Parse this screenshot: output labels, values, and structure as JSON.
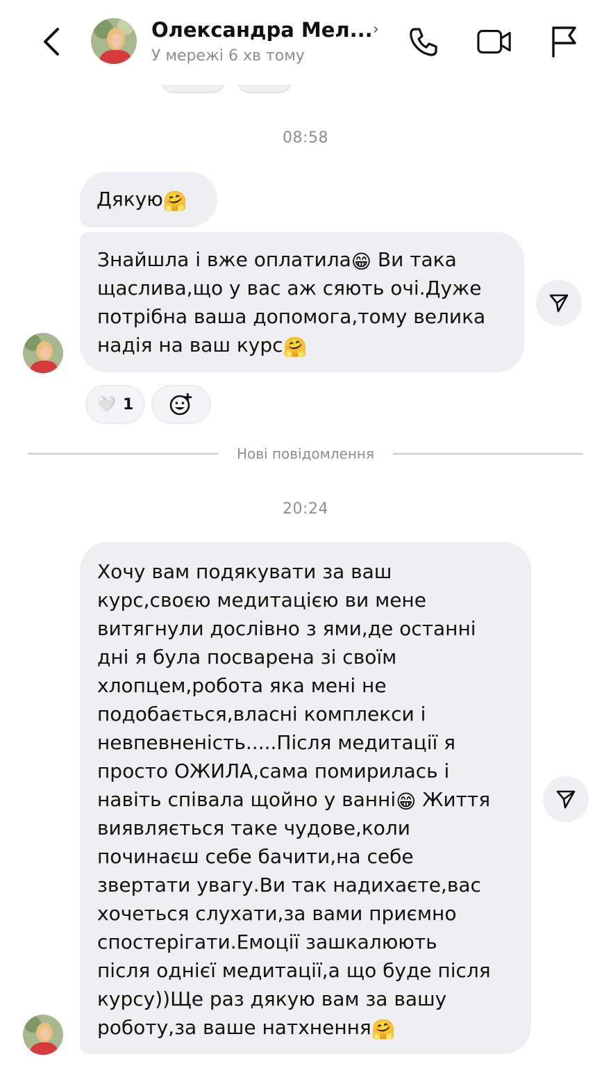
{
  "header": {
    "name": "Олександра Мел...",
    "chevron": "›",
    "status": "У мережі 6 хв тому",
    "icons": [
      "back-arrow-icon",
      "phone-icon",
      "video-camera-icon",
      "flag-icon"
    ]
  },
  "conversation": {
    "time_1": "08:58",
    "messages_1": [
      {
        "text": "Дякую",
        "emoji": "🤗"
      },
      {
        "lines": [
          {
            "text": "Знайшла і вже оплатила",
            "emoji": "😁",
            "after": " Ви така"
          },
          {
            "text": "щаслива,що у вас аж сяють очі.Дуже"
          },
          {
            "text": "потрібна ваша допомога,тому велика"
          },
          {
            "text": "надія на ваш курс",
            "emoji": "🤗"
          }
        ]
      }
    ],
    "reaction": {
      "heart": "🤍",
      "count": "1",
      "add_icon": "add-reaction-icon"
    },
    "new_messages_divider": "Нові повідомлення",
    "time_2": "20:24",
    "message_2": {
      "lines": [
        {
          "text": "Хочу вам подякувати за ваш"
        },
        {
          "text": "курс,своєю медитацією ви мене"
        },
        {
          "text": "витягнули дослівно з ями,де останні"
        },
        {
          "text": "дні я була посварена зі своїм"
        },
        {
          "text": "хлопцем,робота яка мені не"
        },
        {
          "text": "подобається,власні комплекси і"
        },
        {
          "text": "невпевненість.....Після медитації я"
        },
        {
          "text": "просто ОЖИЛА,сама помирилась і"
        },
        {
          "text": "навіть співала щойно у ванні",
          "emoji": "😁",
          "after": " Життя"
        },
        {
          "text": "виявляється таке чудове,коли"
        },
        {
          "text": "починаєш себе бачити,на себе"
        },
        {
          "text": "звертати увагу.Ви так надихаєте,вас"
        },
        {
          "text": "хочеться слухати,за вами приємно"
        },
        {
          "text": "спостерігати.Емоції зашкалюють"
        },
        {
          "text": "після однієї медитації,а що буде після"
        },
        {
          "text": "курсу))Ще раз дякую вам за вашу"
        },
        {
          "text": "роботу,за ваше натхнення",
          "emoji": "🤗"
        }
      ]
    }
  }
}
